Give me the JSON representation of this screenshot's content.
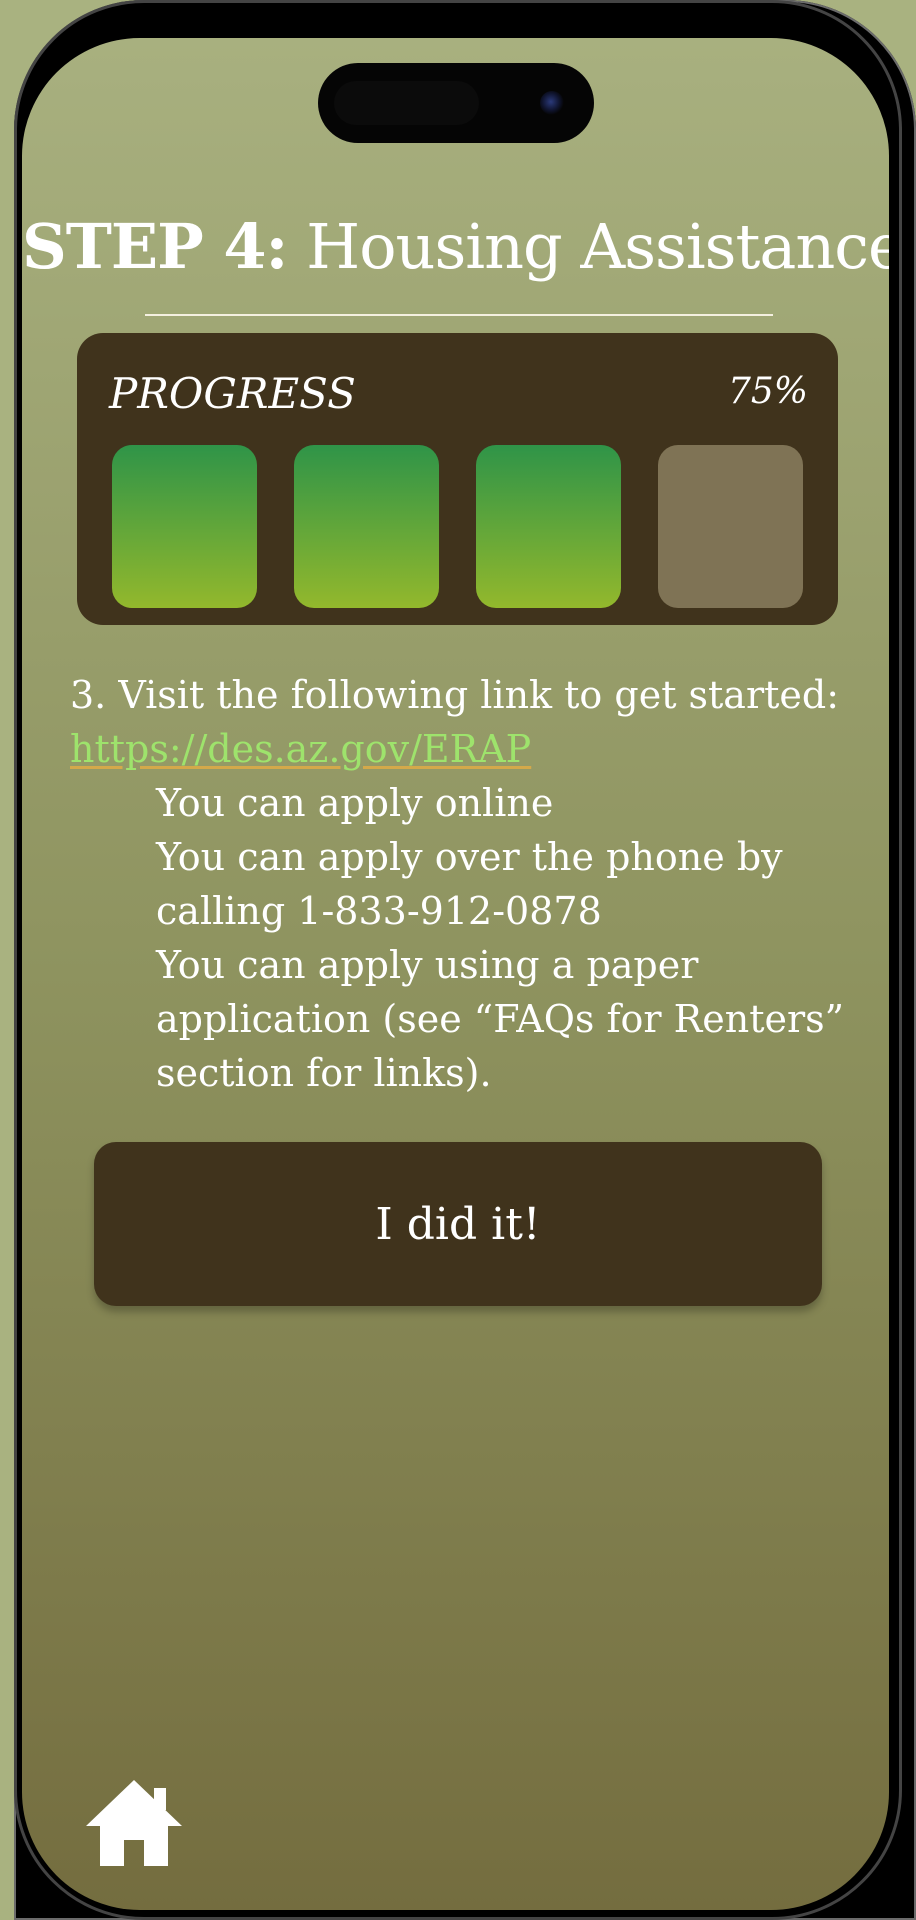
{
  "header": {
    "step_label": "STEP 4:",
    "title": "Housing Assistance"
  },
  "progress": {
    "label": "PROGRESS",
    "percent_text": "75%",
    "completed_segments": 3,
    "total_segments": 4,
    "colors": {
      "panel": "#40331c",
      "complete_top": "#2f9448",
      "complete_bottom": "#93b82c",
      "incomplete": "#7f7355"
    }
  },
  "instructions": {
    "intro": "3. Visit the following link to get started:",
    "link": "https://des.az.gov/ERAP",
    "lines": [
      "You can apply online",
      "You can apply over the phone by",
      "calling 1-833-912-0878",
      "You can apply using a paper",
      "application (see “FAQs for Renters”",
      "section for links)."
    ]
  },
  "actions": {
    "done_label": "I did it!"
  },
  "nav": {
    "home_icon": "home-icon"
  },
  "colors": {
    "background_top": "#a8b07f",
    "background_bottom": "#746d3f",
    "link": "#9ee36c"
  }
}
